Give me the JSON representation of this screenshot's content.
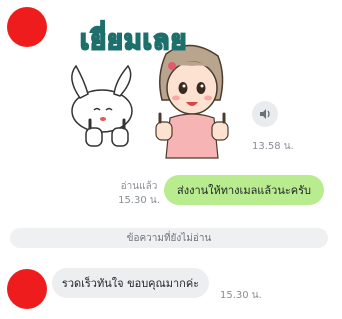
{
  "chat": {
    "sticker": {
      "title": "เยี่ยมเลย",
      "icon": "cartoon-girl-and-rabbit-thumbs-up-sticker"
    },
    "sticker_time": "13.58 น.",
    "sound_icon": "speaker-icon",
    "outgoing": {
      "read_label": "อ่านแล้ว",
      "time": "15.30 น.",
      "text": "ส่งงานให้ทางเมลแล้วนะครับ"
    },
    "unread_divider": "ข้อความที่ยังไม่อ่าน",
    "incoming": {
      "text": "รวดเร็วทันใจ ขอบคุณมากค่ะ",
      "time": "15.30 น."
    },
    "colors": {
      "avatar": "#ee1c1c",
      "outgoing_bubble": "#b9ec8f",
      "incoming_bubble": "#eceef0"
    }
  }
}
